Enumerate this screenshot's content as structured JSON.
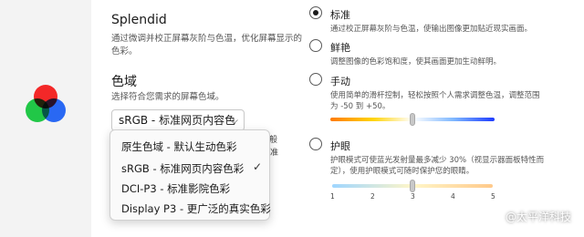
{
  "splendid": {
    "title": "Splendid",
    "desc_line1": "通过微调并校正屏幕灰阶与色温，优化屏幕显示的",
    "desc_line2": "色彩。"
  },
  "gamut": {
    "title": "色域",
    "desc": "选择符合您需求的屏幕色域。",
    "selected": "sRGB - 标准网页内容色",
    "hint_right1": "一般",
    "hint_right2": "准"
  },
  "dropdown": {
    "items": [
      "原生色域 - 默认生动色彩",
      "sRGB - 标准网页内容色彩",
      "DCI-P3 - 标准影院色彩",
      "Display P3 - 更广泛的真实色彩"
    ],
    "checked_index": 1,
    "check_glyph": "✓"
  },
  "modes": {
    "standard": {
      "title": "标准",
      "desc": "通过校正屏幕灰阶与色温，使输出图像更加贴近现实画面。",
      "selected": true
    },
    "vivid": {
      "title": "鲜艳",
      "desc": "调整图像的色彩饱和度，使其画面更加生动鲜明。"
    },
    "manual": {
      "title": "手动",
      "desc_line1": "使用简单的滑杆控制，轻松按照个人需求调整色温，调整范围",
      "desc_line2": "为 -50 到 +50。",
      "slider_value": 0
    },
    "eyecare": {
      "title": "护眼",
      "desc_line1": "护眼模式可使蓝光发射量最多减少 30%（视显示器面板特性而",
      "desc_line2": "定），使用护眼模式可随时保护您的眼睛。",
      "ticks": [
        "1",
        "2",
        "3",
        "4",
        "5"
      ],
      "slider_value": 3
    }
  },
  "watermark": "@太平洋科技",
  "colors": {
    "sidebar_bg": "#f3f3f3",
    "manual_gradient": [
      "#ff7a00",
      "#ffd200",
      "#ffffff",
      "#7fb8ff",
      "#1e3cff"
    ],
    "eyecare_gradient": [
      "#9fd6ff",
      "#fff6c8",
      "#ffc98a"
    ]
  }
}
